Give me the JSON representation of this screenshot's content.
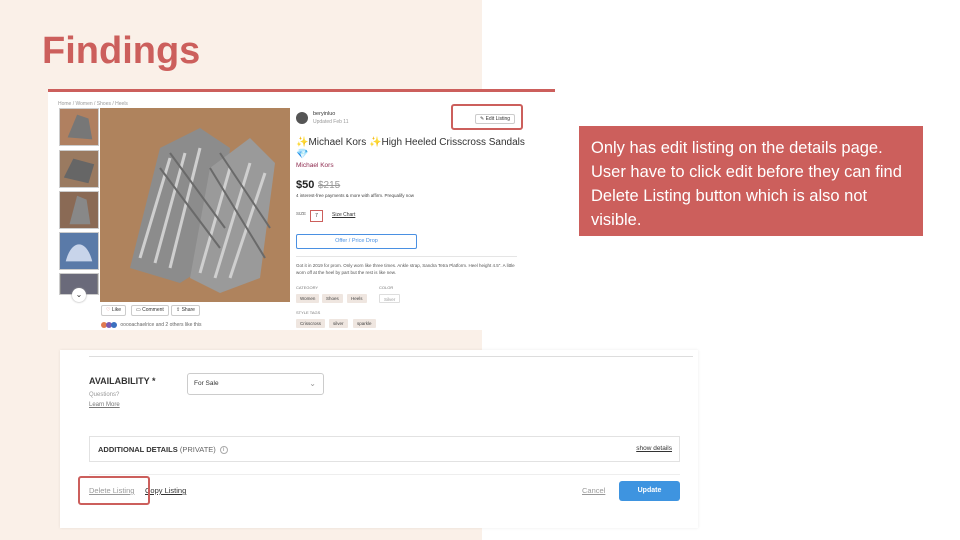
{
  "slide": {
    "title": "Findings",
    "note": "Only has edit listing on the details page. User have to click edit before they can find Delete Listing button which is also not visible."
  },
  "details_page": {
    "breadcrumb": "Home / Women / Shoes / Heels",
    "seller": {
      "name": "beryinluo",
      "updated": "Updated Feb 11"
    },
    "edit_listing": "Edit Listing",
    "title": "✨Michael Kors ✨High Heeled Crisscross Sandals 💎",
    "brand": "Michael Kors",
    "price": "$50",
    "original_price": "$215",
    "affirm_text": "4 interest-free payments & more with affirm. Prequalify now",
    "size_label": "SIZE",
    "size_value": "7",
    "size_chart": "Size Chart",
    "offer_button": "Offer / Price Drop",
    "description": "Got it in 2019 for prom. Only worn like three times. Ankle strap, Sandra Tetra Platform. Heel height 4.5\". A little worn off at the heel by part but the rest is like new.",
    "category_label": "CATEGORY",
    "category_tags": [
      "Women",
      "Shoes",
      "Heels"
    ],
    "color_label": "COLOR",
    "color_tag": "Silver",
    "style_label": "STYLE TAGS",
    "style_tags": [
      "Crisscross",
      "silver",
      "sparkle"
    ],
    "social": {
      "like": "Like",
      "comment": "Comment",
      "share": "Share"
    },
    "likers_text": "ooooachaelrice and 2 others like this"
  },
  "edit_page": {
    "availability_label": "AVAILABILITY *",
    "questions": "Questions?",
    "learn_more": "Learn More",
    "availability_value": "For Sale",
    "additional_details": "ADDITIONAL DETAILS",
    "additional_private": "(PRIVATE)",
    "show_details": "show details",
    "delete_listing": "Delete Listing",
    "copy_listing": "Copy Listing",
    "cancel": "Cancel",
    "update": "Update"
  },
  "colors": {
    "accent": "#cc5f5c",
    "update_button": "#3e94e0",
    "brand_link": "#8e2a4e"
  }
}
